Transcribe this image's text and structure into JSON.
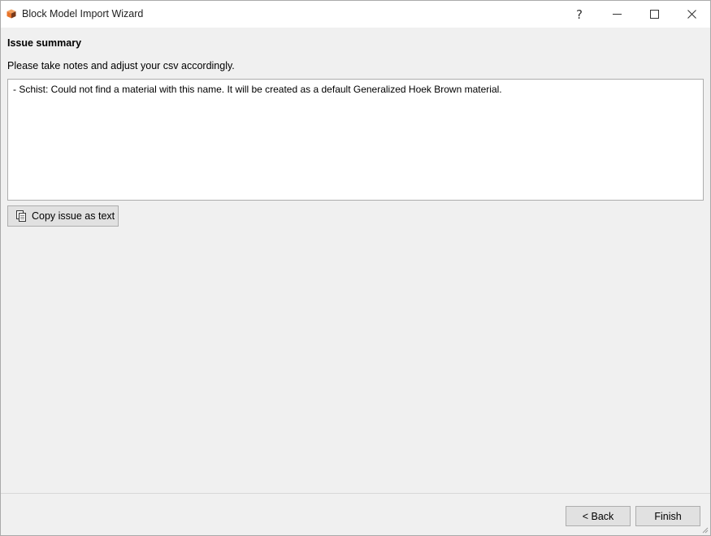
{
  "window": {
    "title": "Block Model Import Wizard",
    "icon": "block-model-app-icon",
    "controls": {
      "help": "?",
      "minimize_icon": "minimize-icon",
      "maximize_icon": "maximize-icon",
      "close_icon": "close-icon"
    }
  },
  "page": {
    "heading": "Issue summary",
    "instruction": "Please take notes and adjust your csv accordingly.",
    "issues": [
      "- Schist: Could not find a material with this name. It will be created as a default Generalized Hoek Brown material."
    ],
    "copy_button": {
      "label": "Copy issue as text",
      "icon": "copy-icon"
    }
  },
  "footer": {
    "back_label": "< Back",
    "finish_label": "Finish"
  },
  "colors": {
    "window_bg": "#f0f0f0",
    "titlebar_bg": "#ffffff",
    "button_bg": "#e1e1e1",
    "button_border": "#adadad",
    "icon_orange": "#e8742a",
    "icon_dark": "#7a3a1a"
  }
}
